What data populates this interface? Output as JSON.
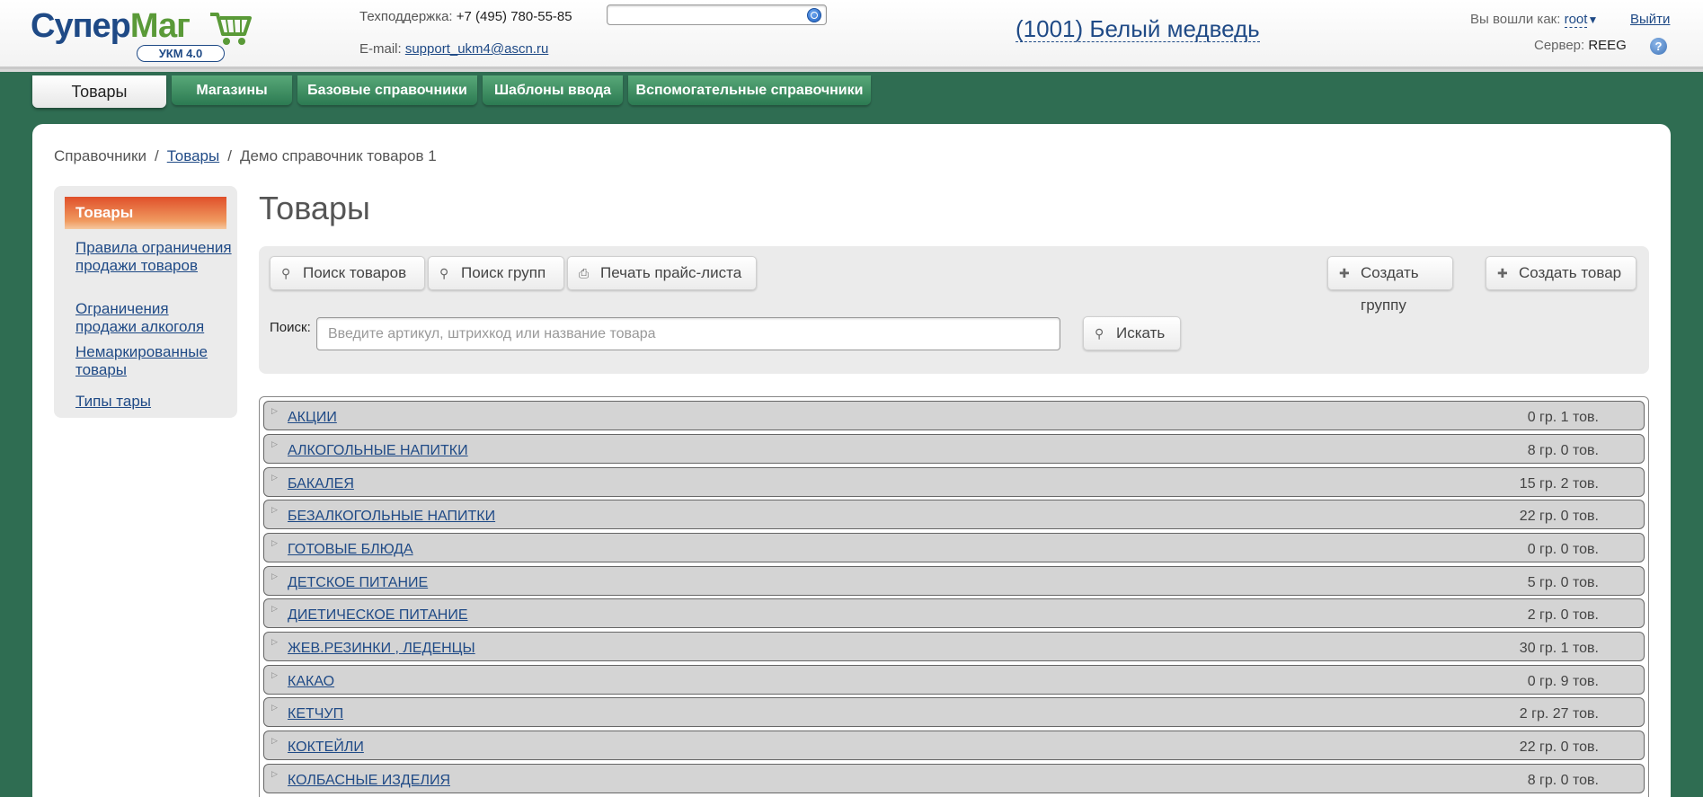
{
  "logo": {
    "part1": "Супер",
    "part2": "Маг",
    "badge": "УКМ 4.0"
  },
  "header": {
    "support_label": "Техподдержка:",
    "support_phone": "+7 (495) 780-55-85",
    "email_label": "E-mail:",
    "email": "support_ukm4@ascn.ru",
    "search_placeholder": "",
    "store_name": "(1001) Белый медведь",
    "logged_in_label": "Вы вошли как:",
    "user": "root",
    "logout": "Выйти",
    "server_label": "Сервер:",
    "server": "REEG",
    "help": "?"
  },
  "tabs": [
    "Товары",
    "Магазины",
    "Базовые справочники",
    "Шаблоны ввода",
    "Вспомогательные справочники"
  ],
  "breadcrumb": {
    "root": "Справочники",
    "link": "Товары",
    "current": "Демо справочник товаров 1"
  },
  "sidebar": {
    "active": "Товары",
    "links": [
      "Правила ограничения продажи товаров",
      "Ограничения продажи алкоголя",
      "Немаркированные товары",
      "Типы тары"
    ]
  },
  "page_title": "Товары",
  "toolbar": {
    "search_goods": "Поиск товаров",
    "search_groups": "Поиск групп",
    "print_price": "Печать прайс-листа",
    "create_group": "Создать группу",
    "create_good": "Создать товар",
    "search_label": "Поиск:",
    "search_placeholder": "Введите артикул, штрихкод или название товара",
    "search_button": "Искать"
  },
  "groups": [
    {
      "name": "АКЦИИ",
      "count": "0 гр. 1 тов."
    },
    {
      "name": "АЛКОГОЛЬНЫЕ НАПИТКИ",
      "count": "8 гр. 0 тов."
    },
    {
      "name": "БАКАЛЕЯ",
      "count": "15 гр. 2 тов."
    },
    {
      "name": "БЕЗАЛКОГОЛЬНЫЕ НАПИТКИ",
      "count": "22 гр. 0 тов."
    },
    {
      "name": "ГОТОВЫЕ БЛЮДА",
      "count": "0 гр. 0 тов."
    },
    {
      "name": "ДЕТСКОЕ ПИТАНИЕ",
      "count": "5 гр. 0 тов."
    },
    {
      "name": "ДИЕТИЧЕСКОЕ ПИТАНИЕ",
      "count": "2 гр. 0 тов."
    },
    {
      "name": "ЖЕВ.РЕЗИНКИ , ЛЕДЕНЦЫ",
      "count": "30 гр. 1 тов."
    },
    {
      "name": "КАКАО",
      "count": "0 гр. 9 тов."
    },
    {
      "name": "КЕТЧУП",
      "count": "2 гр. 27 тов."
    },
    {
      "name": "КОКТЕЙЛИ",
      "count": "22 гр. 0 тов."
    },
    {
      "name": "КОЛБАСНЫЕ ИЗДЕЛИЯ",
      "count": "8 гр. 0 тов."
    }
  ]
}
